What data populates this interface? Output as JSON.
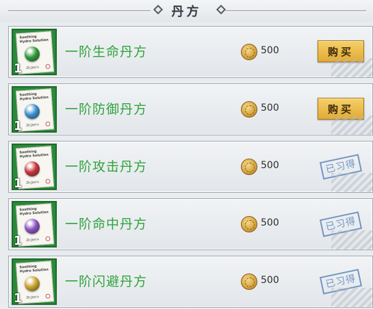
{
  "header": {
    "title": "丹方"
  },
  "recipes": [
    {
      "level": "1",
      "name": "一阶生命丹方",
      "price": "500",
      "status": "buy",
      "action_label": "购买",
      "pill_color": "#2f9a3a",
      "paper_text": [
        "Soothing",
        "Hydro Solution"
      ],
      "paper_signature": "Dr.Jeri+"
    },
    {
      "level": "1",
      "name": "一阶防御丹方",
      "price": "500",
      "status": "buy",
      "action_label": "购买",
      "pill_color": "#3b8fd1",
      "paper_text": [
        "Soothing",
        "Hydro Solution"
      ],
      "paper_signature": "Dr.Jeri+"
    },
    {
      "level": "1",
      "name": "一阶攻击丹方",
      "price": "500",
      "status": "learned",
      "action_label": "已习得",
      "pill_color": "#c8343c",
      "paper_text": [
        "Soothing",
        "Hydro Solution"
      ],
      "paper_signature": "Dr.Jeri+"
    },
    {
      "level": "1",
      "name": "一阶命中丹方",
      "price": "500",
      "status": "learned",
      "action_label": "已习得",
      "pill_color": "#8a52c4",
      "paper_text": [
        "Soothing",
        "Hydro Solution"
      ],
      "paper_signature": "Dr.Jeri+"
    },
    {
      "level": "1",
      "name": "一阶闪避丹方",
      "price": "500",
      "status": "learned",
      "action_label": "已习得",
      "pill_color": "#c9a22c",
      "paper_text": [
        "Soothing",
        "Hydro Solution"
      ],
      "paper_signature": "Dr.Jeri+"
    }
  ],
  "colors": {
    "name_text": "#2fa33c",
    "buy_button": "#e8b84a",
    "learned_stamp": "#5f86bd"
  }
}
